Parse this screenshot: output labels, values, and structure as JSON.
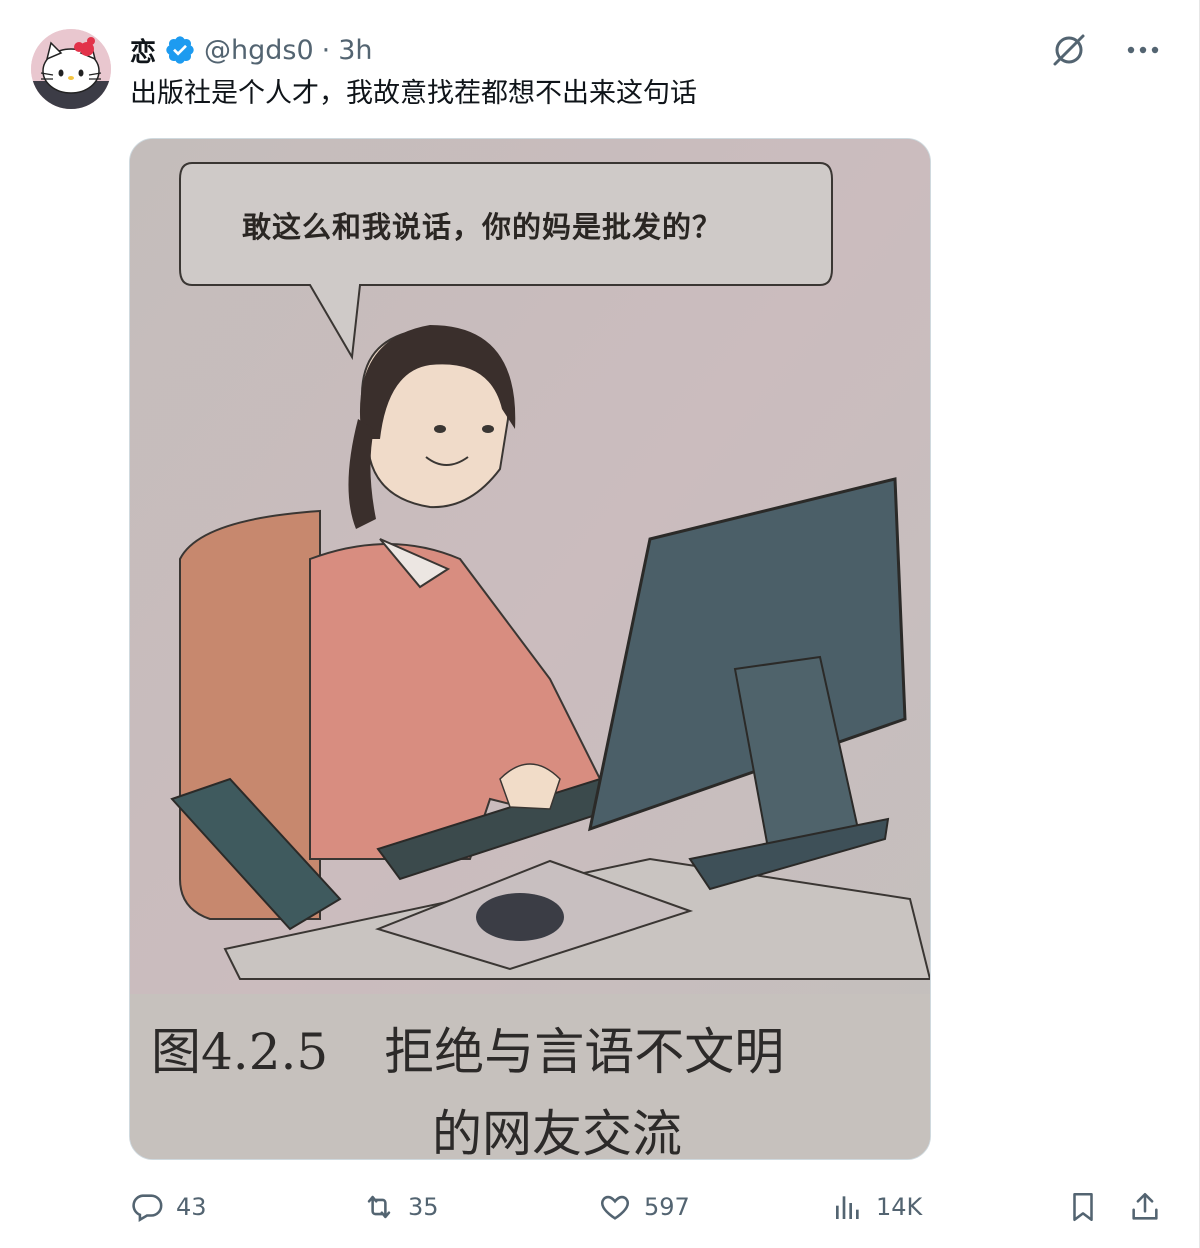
{
  "author": {
    "name": "恋",
    "handle": "@hgds0",
    "separator": "·",
    "time": "3h",
    "verified": true
  },
  "tweet": {
    "text": "出版社是个人才，我故意找茬都想不出来这句话"
  },
  "media": {
    "speech_bubble": "敢这么和我说话，你的妈是批发的？",
    "caption_number": "图4.2.5",
    "caption_line1": "拒绝与言语不文明",
    "caption_line2": "的网友交流"
  },
  "actions": {
    "replies": "43",
    "reposts": "35",
    "likes": "597",
    "views": "14K"
  },
  "icons": {
    "header": [
      "grok-icon",
      "more-icon"
    ],
    "footer": [
      "reply-icon",
      "repost-icon",
      "like-icon",
      "views-icon",
      "bookmark-icon",
      "share-icon"
    ]
  },
  "colors": {
    "verified_blue": "#1d9bf0",
    "muted_text": "#536471",
    "main_text": "#0f1419"
  }
}
